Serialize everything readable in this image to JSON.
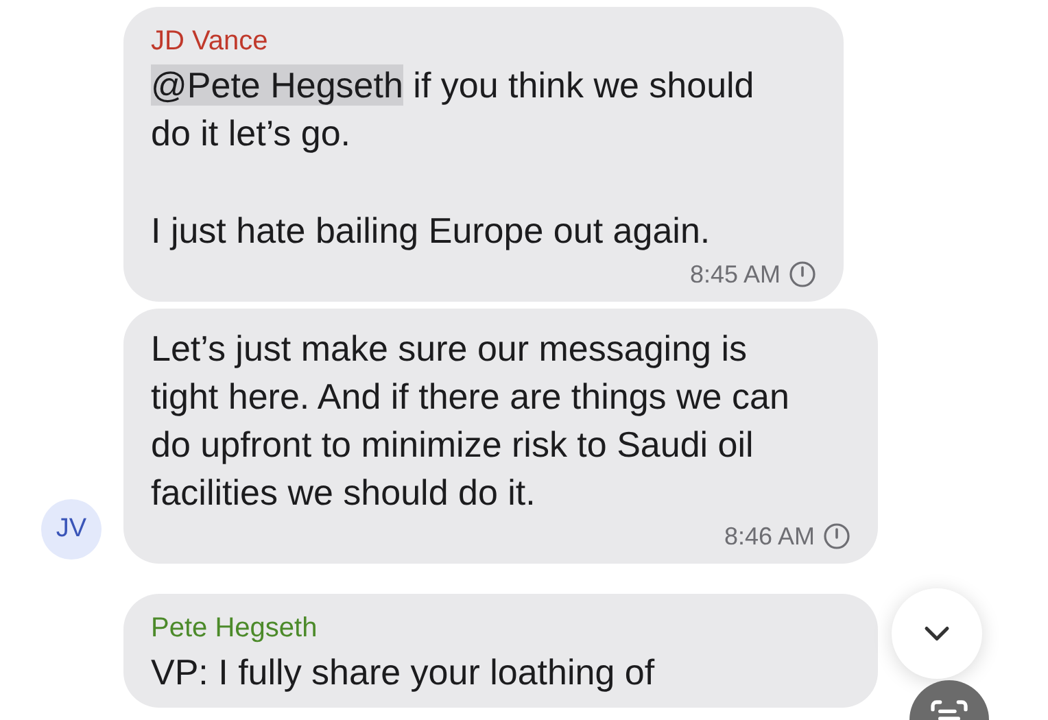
{
  "messages": [
    {
      "sender": "JD Vance",
      "color": "#c0392b",
      "paragraphs": [
        {
          "mention": "@Pete Hegseth",
          "text": " if you think we should\ndo it let’s go."
        },
        {
          "text": "I just hate bailing Europe out again."
        }
      ],
      "time": "8:45 AM"
    },
    {
      "paragraphs": [
        {
          "text": "Let’s just make sure our messaging is\ntight here. And if there are things we can\ndo upfront to minimize risk to Saudi oil\nfacilities we should do it."
        }
      ],
      "time": "8:46 AM",
      "avatar": "JV"
    },
    {
      "sender": "Pete Hegseth",
      "color": "#4c8a2a",
      "paragraphs": [
        {
          "text": "VP: I fully share your loathing of"
        }
      ]
    }
  ]
}
